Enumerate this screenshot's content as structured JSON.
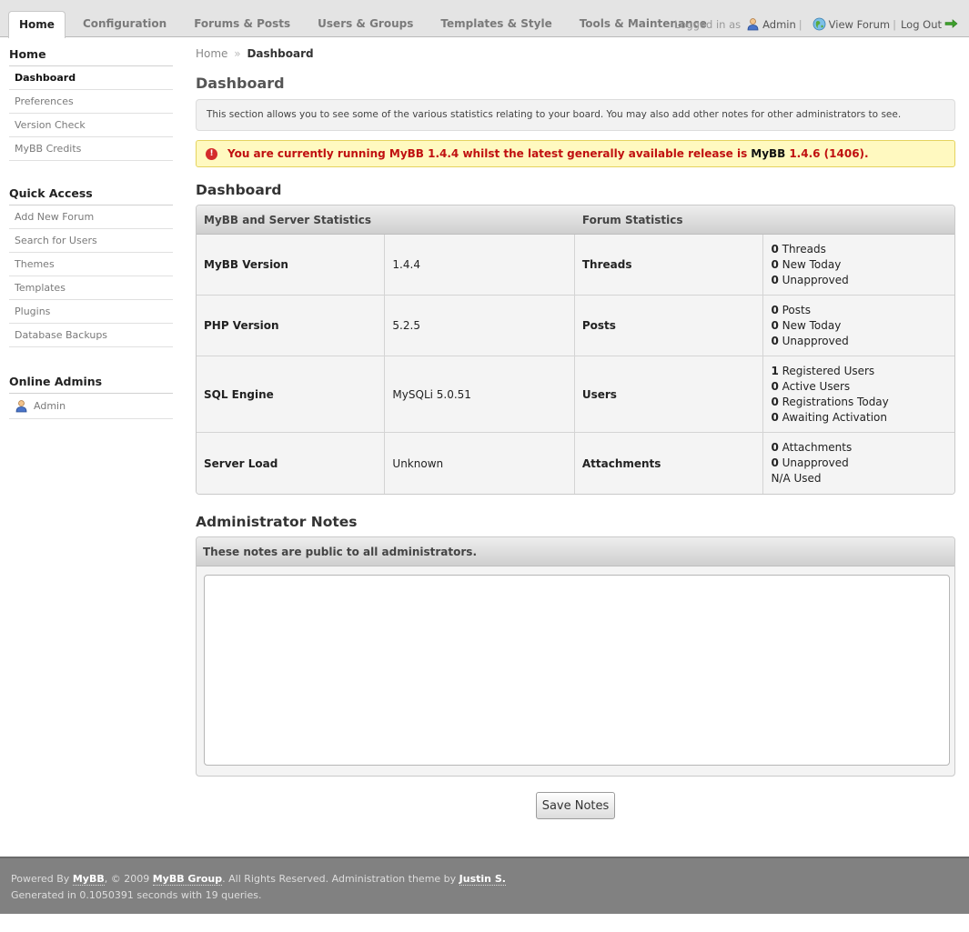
{
  "nav": {
    "tabs": [
      {
        "label": "Home",
        "active": true
      },
      {
        "label": "Configuration"
      },
      {
        "label": "Forums & Posts"
      },
      {
        "label": "Users & Groups"
      },
      {
        "label": "Templates & Style"
      },
      {
        "label": "Tools & Maintenance"
      }
    ]
  },
  "userbar": {
    "logged_in_as": "Logged in as",
    "username": "Admin",
    "view_forum": "View Forum",
    "log_out": "Log Out",
    "separator": "|"
  },
  "sidebar": {
    "sections": [
      {
        "title": "Home",
        "items": [
          "Dashboard",
          "Preferences",
          "Version Check",
          "MyBB Credits"
        ]
      },
      {
        "title": "Quick Access",
        "items": [
          "Add New Forum",
          "Search for Users",
          "Themes",
          "Templates",
          "Plugins",
          "Database Backups"
        ]
      },
      {
        "title": "Online Admins",
        "items": [
          "Admin"
        ]
      }
    ]
  },
  "breadcrumb": {
    "home": "Home",
    "sep": "»",
    "current": "Dashboard"
  },
  "page_title": "Dashboard",
  "description": "This section allows you to see some of the various statistics relating to your board. You may also add other notes for other administrators to see.",
  "alert": {
    "prefix": "You are currently running MyBB 1.4.4 whilst the latest generally available release is",
    "product": "MyBB",
    "latest": "1.4.6 (1406)."
  },
  "stats": {
    "title": "Dashboard",
    "headers": [
      "MyBB and Server Statistics",
      "Forum Statistics"
    ],
    "rows": [
      {
        "label": "MyBB Version",
        "value": "1.4.4",
        "flabel": "Threads",
        "fvalues": [
          [
            "0",
            "Threads"
          ],
          [
            "0",
            "New Today"
          ],
          [
            "0",
            "Unapproved"
          ]
        ]
      },
      {
        "label": "PHP Version",
        "value": "5.2.5",
        "flabel": "Posts",
        "fvalues": [
          [
            "0",
            "Posts"
          ],
          [
            "0",
            "New Today"
          ],
          [
            "0",
            "Unapproved"
          ]
        ]
      },
      {
        "label": "SQL Engine",
        "value": "MySQLi 5.0.51",
        "flabel": "Users",
        "fvalues": [
          [
            "1",
            "Registered Users"
          ],
          [
            "0",
            "Active Users"
          ],
          [
            "0",
            "Registrations Today"
          ],
          [
            "0",
            "Awaiting Activation"
          ]
        ]
      },
      {
        "label": "Server Load",
        "value": "Unknown",
        "flabel": "Attachments",
        "fvalues": [
          [
            "0",
            "Attachments"
          ],
          [
            "0",
            "Unapproved"
          ],
          [
            "N/A",
            "Used"
          ]
        ]
      }
    ]
  },
  "notes": {
    "title": "Administrator Notes",
    "header": "These notes are public to all administrators.",
    "value": "",
    "save_label": "Save Notes"
  },
  "footer": {
    "powered_by": "Powered By",
    "mybb": "MyBB",
    "copyright": ", © 2009",
    "group": "MyBB Group",
    "rights": ". All Rights Reserved. Administration theme by",
    "author": "Justin S.",
    "generated": "Generated in 0.1050391 seconds with 19 queries."
  }
}
